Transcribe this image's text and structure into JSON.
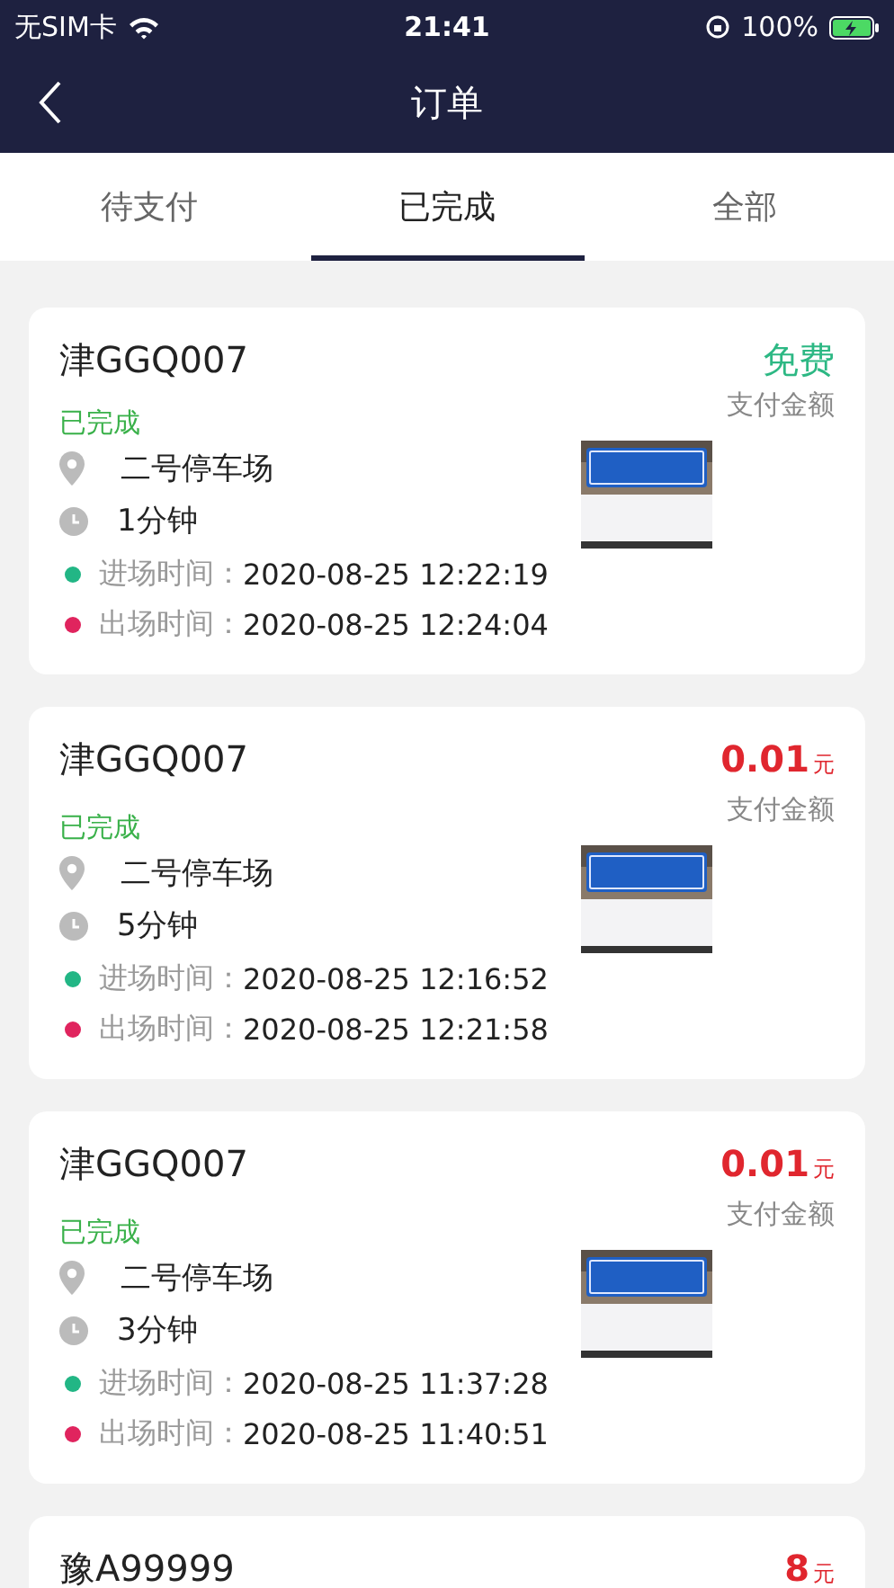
{
  "status_bar": {
    "carrier": "无SIM卡",
    "time": "21:41",
    "battery": "100%"
  },
  "nav": {
    "title": "订单"
  },
  "tabs": [
    {
      "label": "待支付",
      "selected": false
    },
    {
      "label": "已完成",
      "selected": true
    },
    {
      "label": "全部",
      "selected": false
    }
  ],
  "orders": [
    {
      "plate": "津GGQ007",
      "status": "已完成",
      "price": {
        "kind": "free",
        "amount": "免费"
      },
      "price_caption": "支付金额",
      "location": "二号停车场",
      "duration": "1分钟",
      "photo": {
        "kind": "picture"
      },
      "times": [
        {
          "label": "进场时间：",
          "value": "2020-08-25 12:22:19",
          "color": "#22b685"
        },
        {
          "label": "出场时间：",
          "value": "2020-08-25 12:24:04",
          "color": "#e0245e"
        }
      ]
    },
    {
      "plate": "津GGQ007",
      "status": "已完成",
      "price": {
        "kind": "paid",
        "amount": "0.01",
        "unit": "元"
      },
      "price_caption": "支付金额",
      "location": "二号停车场",
      "duration": "5分钟",
      "photo": {
        "kind": "picture"
      },
      "times": [
        {
          "label": "进场时间：",
          "value": "2020-08-25 12:16:52",
          "color": "#22b685"
        },
        {
          "label": "出场时间：",
          "value": "2020-08-25 12:21:58",
          "color": "#e0245e"
        }
      ]
    },
    {
      "plate": "津GGQ007",
      "status": "已完成",
      "price": {
        "kind": "paid",
        "amount": "0.01",
        "unit": "元"
      },
      "price_caption": "支付金额",
      "location": "二号停车场",
      "duration": "3分钟",
      "photo": {
        "kind": "picture"
      },
      "times": [
        {
          "label": "进场时间：",
          "value": "2020-08-25 11:37:28",
          "color": "#22b685"
        },
        {
          "label": "出场时间：",
          "value": "2020-08-25 11:40:51",
          "color": "#e0245e"
        }
      ]
    },
    {
      "plate": "豫A99999",
      "price": {
        "kind": "paid",
        "amount": "8",
        "unit": "元"
      }
    }
  ]
}
